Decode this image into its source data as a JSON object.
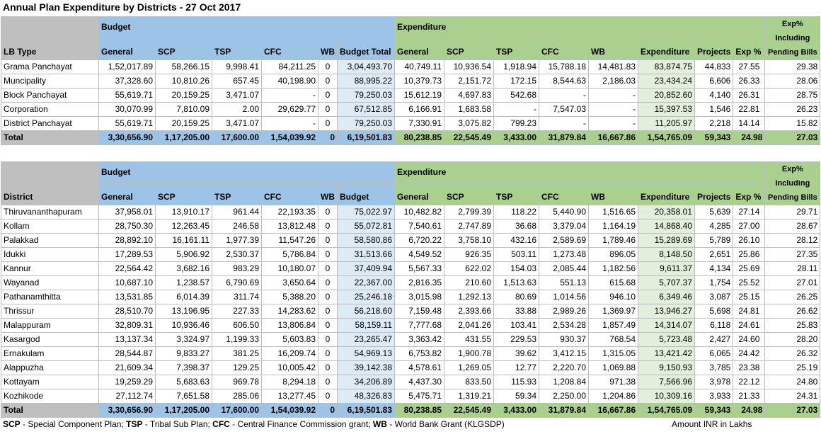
{
  "title": "Annual Plan Expenditure by Districts - 27 Oct 2017",
  "group_labels": {
    "budget": "Budget",
    "expenditure": "Expenditure"
  },
  "table1": {
    "first_col": "LB Type",
    "headers": [
      "General",
      "SCP",
      "TSP",
      "CFC",
      "WB",
      "Budget Total",
      "General",
      "SCP",
      "TSP",
      "CFC",
      "WB",
      "Expenditure",
      "Projects",
      "Exp %",
      "Exp% Including Pending Bills"
    ],
    "rows": [
      [
        "Grama Panchayat",
        "1,52,017.89",
        "58,266.15",
        "9,998.41",
        "84,211.25",
        "0",
        "3,04,493.70",
        "40,749.11",
        "10,936.54",
        "1,918.94",
        "15,788.18",
        "14,481.83",
        "83,874.75",
        "44,833",
        "27.55",
        "29.38"
      ],
      [
        "Muncipality",
        "37,328.60",
        "10,810.26",
        "657.45",
        "40,198.90",
        "0",
        "88,995.22",
        "10,379.73",
        "2,151.72",
        "172.15",
        "8,544.63",
        "2,186.03",
        "23,434.24",
        "6,606",
        "26.33",
        "28.06"
      ],
      [
        "Block Panchayat",
        "55,619.71",
        "20,159.25",
        "3,471.07",
        "-",
        "0",
        "79,250.03",
        "15,612.19",
        "4,697.83",
        "542.68",
        "-",
        "-",
        "20,852.60",
        "4,140",
        "26.31",
        "28.75"
      ],
      [
        "Corporation",
        "30,070.99",
        "7,810.09",
        "2.00",
        "29,629.77",
        "0",
        "67,512.85",
        "6,166.91",
        "1,683.58",
        "-",
        "7,547.03",
        "-",
        "15,397.53",
        "1,546",
        "22.81",
        "26.23"
      ],
      [
        "District Panchayat",
        "55,619.71",
        "20,159.25",
        "3,471.07",
        "-",
        "0",
        "79,250.03",
        "7,330.91",
        "3,075.82",
        "799.23",
        "-",
        "-",
        "11,205.97",
        "2,218",
        "14.14",
        "15.82"
      ]
    ],
    "total": [
      "Total",
      "3,30,656.90",
      "1,17,205.00",
      "17,600.00",
      "1,54,039.92",
      "0",
      "6,19,501.83",
      "80,238.85",
      "22,545.49",
      "3,433.00",
      "31,879.84",
      "16,667.86",
      "1,54,765.09",
      "59,343",
      "24.98",
      "27.03"
    ]
  },
  "table2": {
    "first_col": "District",
    "headers": [
      "General",
      "SCP",
      "TSP",
      "CFC",
      "WB",
      "Budget",
      "General",
      "SCP",
      "TSP",
      "CFC",
      "WB",
      "Expenditure",
      "Projects",
      "Exp %",
      "Exp% Including Pending Bills"
    ],
    "rows": [
      [
        "Thiruvananthapuram",
        "37,958.01",
        "13,910.17",
        "961.44",
        "22,193.35",
        "0",
        "75,022.97",
        "10,482.82",
        "2,799.39",
        "118.22",
        "5,440.90",
        "1,516.65",
        "20,358.01",
        "5,639",
        "27.14",
        "29.71"
      ],
      [
        "Kollam",
        "28,750.30",
        "12,263.45",
        "246.58",
        "13,812.48",
        "0",
        "55,072.81",
        "7,540.61",
        "2,747.89",
        "36.68",
        "3,379.04",
        "1,164.19",
        "14,868.40",
        "4,285",
        "27.00",
        "28.67"
      ],
      [
        "Palakkad",
        "28,892.10",
        "16,161.11",
        "1,977.39",
        "11,547.26",
        "0",
        "58,580.86",
        "6,720.22",
        "3,758.10",
        "432.16",
        "2,589.69",
        "1,789.46",
        "15,289.69",
        "5,789",
        "26.10",
        "28.12"
      ],
      [
        "Idukki",
        "17,289.53",
        "5,906.92",
        "2,530.37",
        "5,786.84",
        "0",
        "31,513.66",
        "4,549.52",
        "926.35",
        "503.11",
        "1,273.48",
        "896.05",
        "8,148.50",
        "2,651",
        "25.86",
        "27.35"
      ],
      [
        "Kannur",
        "22,564.42",
        "3,682.16",
        "983.29",
        "10,180.07",
        "0",
        "37,409.94",
        "5,567.33",
        "622.02",
        "154.03",
        "2,085.44",
        "1,182.56",
        "9,611.37",
        "4,134",
        "25.69",
        "28.11"
      ],
      [
        "Wayanad",
        "10,687.10",
        "1,238.57",
        "6,790.69",
        "3,650.64",
        "0",
        "22,367.00",
        "2,816.35",
        "210.60",
        "1,513.63",
        "551.13",
        "615.68",
        "5,707.37",
        "1,754",
        "25.52",
        "27.01"
      ],
      [
        "Pathanamthitta",
        "13,531.85",
        "6,014.39",
        "311.74",
        "5,388.20",
        "0",
        "25,246.18",
        "3,015.98",
        "1,292.13",
        "80.69",
        "1,014.56",
        "946.10",
        "6,349.46",
        "3,087",
        "25.15",
        "26.25"
      ],
      [
        "Thrissur",
        "28,510.70",
        "13,196.95",
        "227.33",
        "14,283.62",
        "0",
        "56,218.60",
        "7,159.48",
        "2,393.66",
        "33.88",
        "2,989.26",
        "1,369.97",
        "13,946.27",
        "5,698",
        "24.81",
        "26.62"
      ],
      [
        "Malappuram",
        "32,809.31",
        "10,936.46",
        "606.50",
        "13,806.84",
        "0",
        "58,159.11",
        "7,777.68",
        "2,041.26",
        "103.41",
        "2,534.28",
        "1,857.49",
        "14,314.07",
        "6,118",
        "24.61",
        "25.83"
      ],
      [
        "Kasargod",
        "13,137.34",
        "3,324.97",
        "1,199.33",
        "5,603.83",
        "0",
        "23,265.47",
        "3,363.42",
        "431.55",
        "229.53",
        "930.37",
        "768.54",
        "5,723.48",
        "2,427",
        "24.60",
        "28.20"
      ],
      [
        "Ernakulam",
        "28,544.87",
        "9,833.27",
        "381.25",
        "16,209.74",
        "0",
        "54,969.13",
        "6,753.82",
        "1,900.78",
        "39.62",
        "3,412.15",
        "1,315.05",
        "13,421.42",
        "6,065",
        "24.42",
        "26.32"
      ],
      [
        "Alappuzha",
        "21,609.34",
        "7,398.37",
        "129.25",
        "10,005.42",
        "0",
        "39,142.38",
        "4,578.61",
        "1,269.05",
        "12.77",
        "2,220.70",
        "1,069.88",
        "9,150.93",
        "3,785",
        "23.38",
        "25.19"
      ],
      [
        "Kottayam",
        "19,259.29",
        "5,683.63",
        "969.78",
        "8,294.18",
        "0",
        "34,206.89",
        "4,437.30",
        "833.50",
        "115.93",
        "1,208.84",
        "971.38",
        "7,566.96",
        "3,978",
        "22.12",
        "24.80"
      ],
      [
        "Kozhikode",
        "27,112.74",
        "7,651.58",
        "285.06",
        "13,277.45",
        "0",
        "48,326.83",
        "5,475.71",
        "1,319.21",
        "59.34",
        "2,250.00",
        "1,204.86",
        "10,309.16",
        "3,933",
        "21.33",
        "24.31"
      ]
    ],
    "total": [
      "Total",
      "3,30,656.90",
      "1,17,205.00",
      "17,600.00",
      "1,54,039.92",
      "0",
      "6,19,501.83",
      "80,238.85",
      "22,545.49",
      "3,433.00",
      "31,879.84",
      "16,667.86",
      "1,54,765.09",
      "59,343",
      "24.98",
      "27.03"
    ]
  },
  "footnote": {
    "scp_abbr": "SCP",
    "scp_text": " - Special Component Plan; ",
    "tsp_abbr": "TSP",
    "tsp_text": " - Tribal Sub Plan; ",
    "cfc_abbr": "CFC",
    "cfc_text": " - Central Finance Commission grant; ",
    "wb_abbr": "WB",
    "wb_text": " - World Bank Grant (KLGSDP)",
    "unit": "Amount INR in Lakhs"
  }
}
